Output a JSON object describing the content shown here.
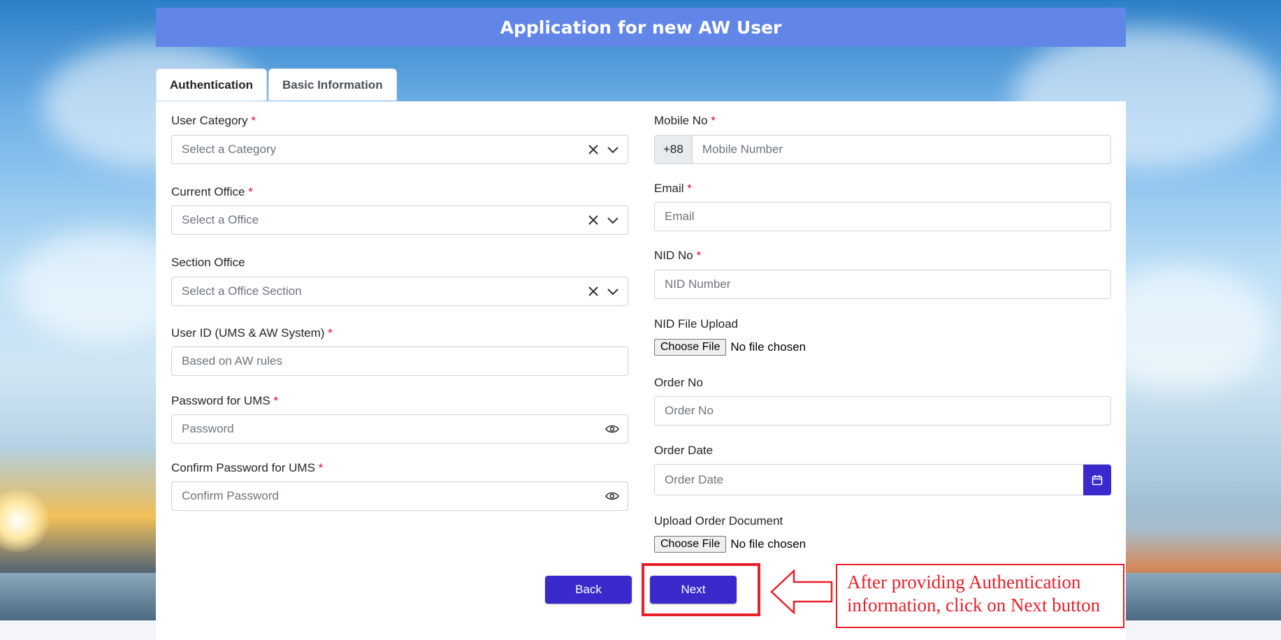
{
  "page_title": "Application for new AW User",
  "tabs": [
    {
      "label": "Authentication",
      "active": true
    },
    {
      "label": "Basic Information",
      "active": false
    }
  ],
  "left": {
    "user_category": {
      "label": "User Category",
      "required": "*",
      "placeholder": "Select a Category"
    },
    "current_office": {
      "label": "Current Office",
      "required": "*",
      "placeholder": "Select a Office"
    },
    "section_office": {
      "label": "Section Office",
      "placeholder": "Select a Office Section"
    },
    "user_id": {
      "label": "User ID (UMS & AW System)",
      "required": "*",
      "placeholder": "Based on AW rules"
    },
    "password": {
      "label": "Password for UMS",
      "required": "*",
      "placeholder": "Password"
    },
    "confirm_password": {
      "label": "Confirm Password for UMS",
      "required": "*",
      "placeholder": "Confirm Password"
    }
  },
  "right": {
    "mobile": {
      "label": "Mobile No",
      "required": "*",
      "prefix": "+88",
      "placeholder": "Mobile Number"
    },
    "email": {
      "label": "Email",
      "required": "*",
      "placeholder": "Email"
    },
    "nid": {
      "label": "NID No",
      "required": "*",
      "placeholder": "NID Number"
    },
    "nid_file": {
      "label": "NID File Upload",
      "button": "Choose File",
      "status": "No file chosen"
    },
    "order_no": {
      "label": "Order No",
      "placeholder": "Order No"
    },
    "order_date": {
      "label": "Order Date",
      "placeholder": "Order Date"
    },
    "order_doc": {
      "label": "Upload Order Document",
      "button": "Choose File",
      "status": "No file chosen"
    }
  },
  "buttons": {
    "back": "Back",
    "next": "Next"
  },
  "annotation": {
    "line1": "After providing Authentication",
    "line2": "information, click on Next button"
  },
  "colors": {
    "header_bg": "#6186e8",
    "primary": "#3a2acb",
    "required": "#e4002b",
    "annotation": "#e8202a"
  }
}
